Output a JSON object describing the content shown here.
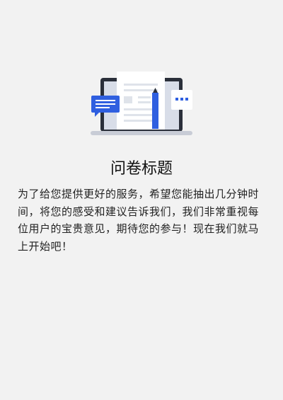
{
  "survey": {
    "title": "问卷标题",
    "description": "为了给您提供更好的服务，希望您能抽出几分钟时间，将您的感受和建议告诉我们，我们非常重视每位用户的宝贵意见，期待您的参与！现在我们就马上开始吧！"
  },
  "colors": {
    "accent": "#2f5fe0"
  }
}
